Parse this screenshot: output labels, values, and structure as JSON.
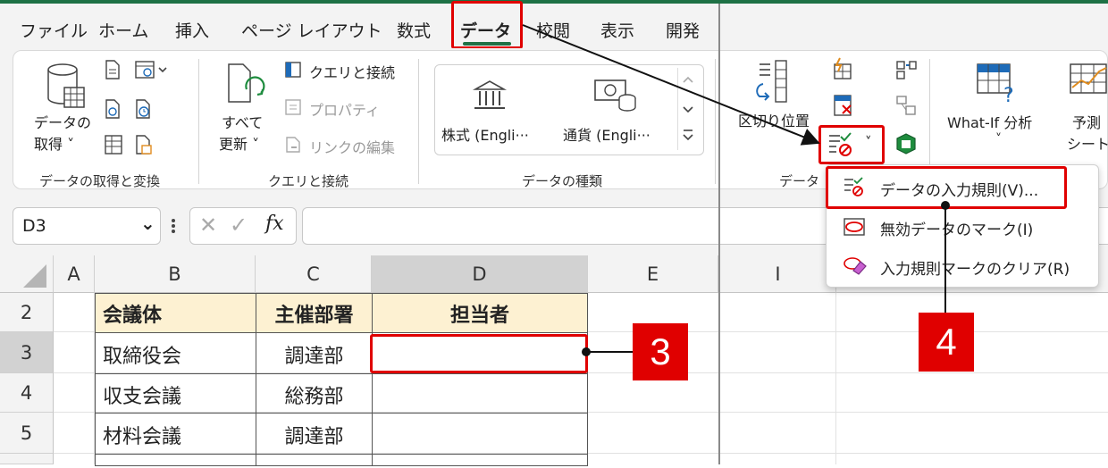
{
  "tabs": [
    "ファイル",
    "ホーム",
    "挿入",
    "ページ レイアウト",
    "数式",
    "データ",
    "校閲",
    "表示",
    "開発"
  ],
  "active_tab": "データ",
  "ribbon": {
    "get_data": {
      "label_line1": "データの",
      "label_line2": "取得 ˅",
      "group": "データの取得と変換"
    },
    "queries": {
      "refresh_line1": "すべて",
      "refresh_line2": "更新 ˅",
      "queries_connections": "クエリと接続",
      "properties": "プロパティ",
      "edit_links": "リンクの編集",
      "group": "クエリと接続"
    },
    "data_types": {
      "stocks": "株式 (Engli···",
      "currency": "通貨 (Engli···",
      "group": "データの種類"
    },
    "data_tools": {
      "text_to_columns": "区切り位置",
      "validation_dropdown": "˅",
      "group": "データ"
    },
    "forecast": {
      "whatif": "What-If 分析",
      "whatif_arrow": "˅",
      "forecast_line1": "予測",
      "forecast_line2": "シート"
    }
  },
  "name_box": "D3",
  "name_box_arrow": "⌄",
  "formula_icons": {
    "cancel": "✕",
    "enter": "✓",
    "fx": "fx"
  },
  "columns": [
    "A",
    "B",
    "C",
    "D",
    "E",
    "I"
  ],
  "rows": [
    {
      "num": "2",
      "b": "会議体",
      "c": "主催部署",
      "d": "担当者"
    },
    {
      "num": "3",
      "b": "取締役会",
      "c": "調達部",
      "d": ""
    },
    {
      "num": "4",
      "b": "収支会議",
      "c": "総務部",
      "d": ""
    },
    {
      "num": "5",
      "b": "材料会議",
      "c": "調達部",
      "d": ""
    }
  ],
  "dropdown_menu": [
    "データの入力規則(V)...",
    "無効データのマーク(I)",
    "入力規則マークのクリア(R)"
  ],
  "callouts": {
    "step3": "3",
    "step4": "4"
  },
  "colors": {
    "accent": "#1e7145",
    "highlight": "#e00000",
    "header_fill": "#fdf1d2"
  }
}
